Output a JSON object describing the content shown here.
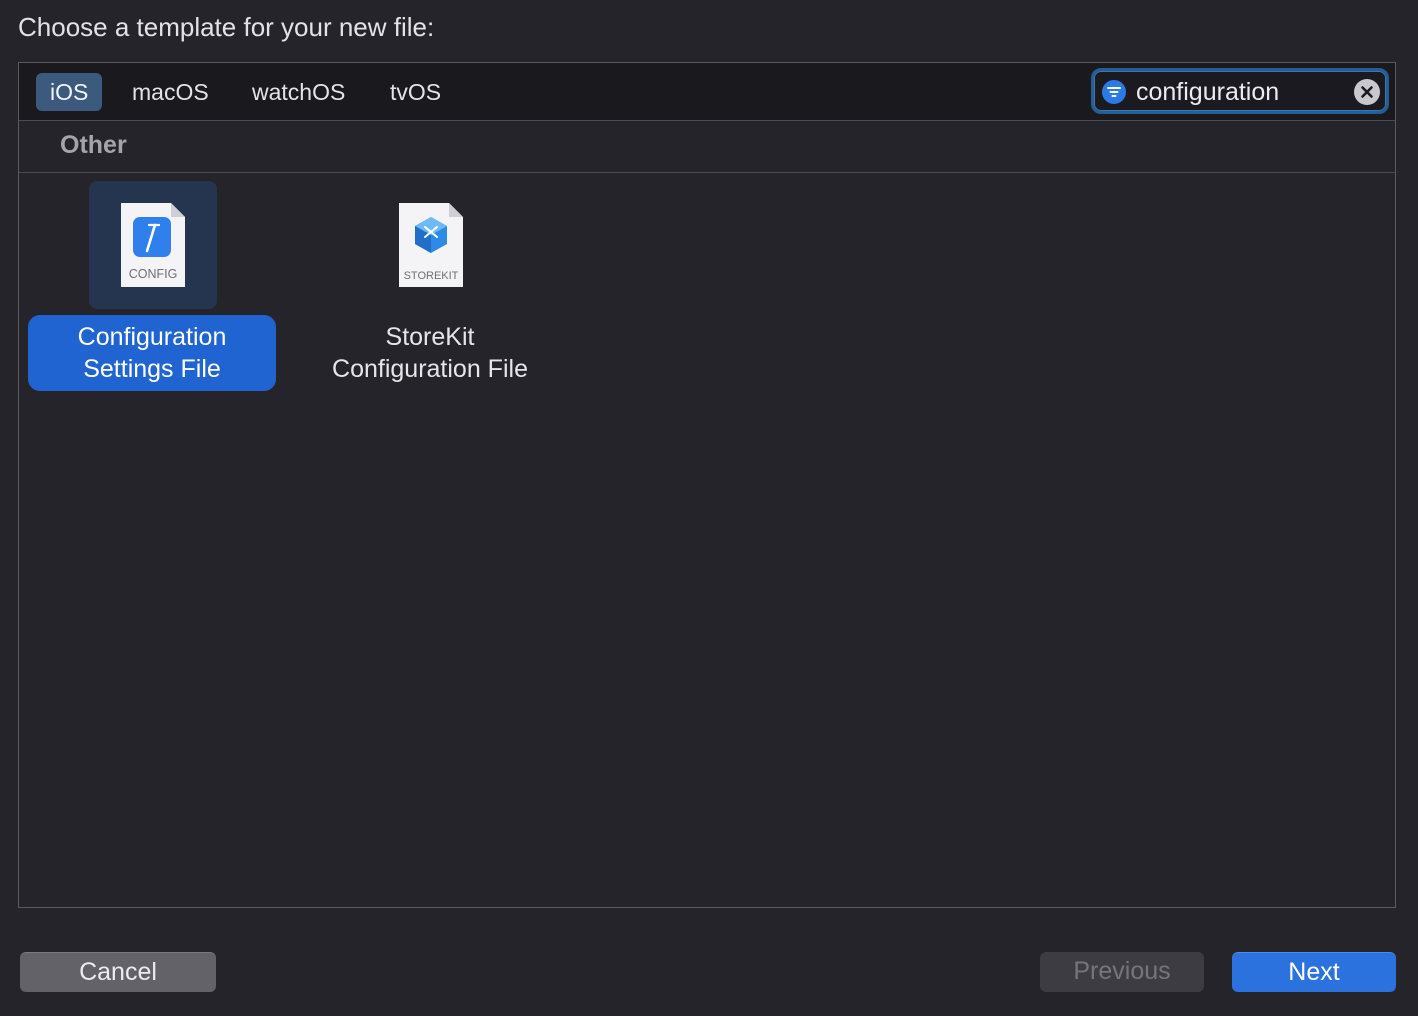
{
  "dialog": {
    "prompt": "Choose a template for your new file:"
  },
  "platforms": {
    "tabs": [
      {
        "label": "iOS",
        "active": true
      },
      {
        "label": "macOS",
        "active": false
      },
      {
        "label": "watchOS",
        "active": false
      },
      {
        "label": "tvOS",
        "active": false
      }
    ]
  },
  "search": {
    "value": "configuration",
    "icon": "filter-icon",
    "clear_icon": "clear-icon"
  },
  "section": {
    "title": "Other"
  },
  "templates": [
    {
      "label_line1": "Configuration",
      "label_line2": "Settings File",
      "badge": "CONFIG",
      "icon": "config-file-icon",
      "selected": true
    },
    {
      "label_line1": "StoreKit",
      "label_line2": "Configuration File",
      "badge": "STOREKIT",
      "icon": "storekit-file-icon",
      "selected": false
    }
  ],
  "buttons": {
    "cancel": "Cancel",
    "previous": "Previous",
    "next": "Next"
  },
  "colors": {
    "accent": "#1f64d1",
    "selected_tab": "#3b5a7e",
    "background": "#25242a"
  }
}
